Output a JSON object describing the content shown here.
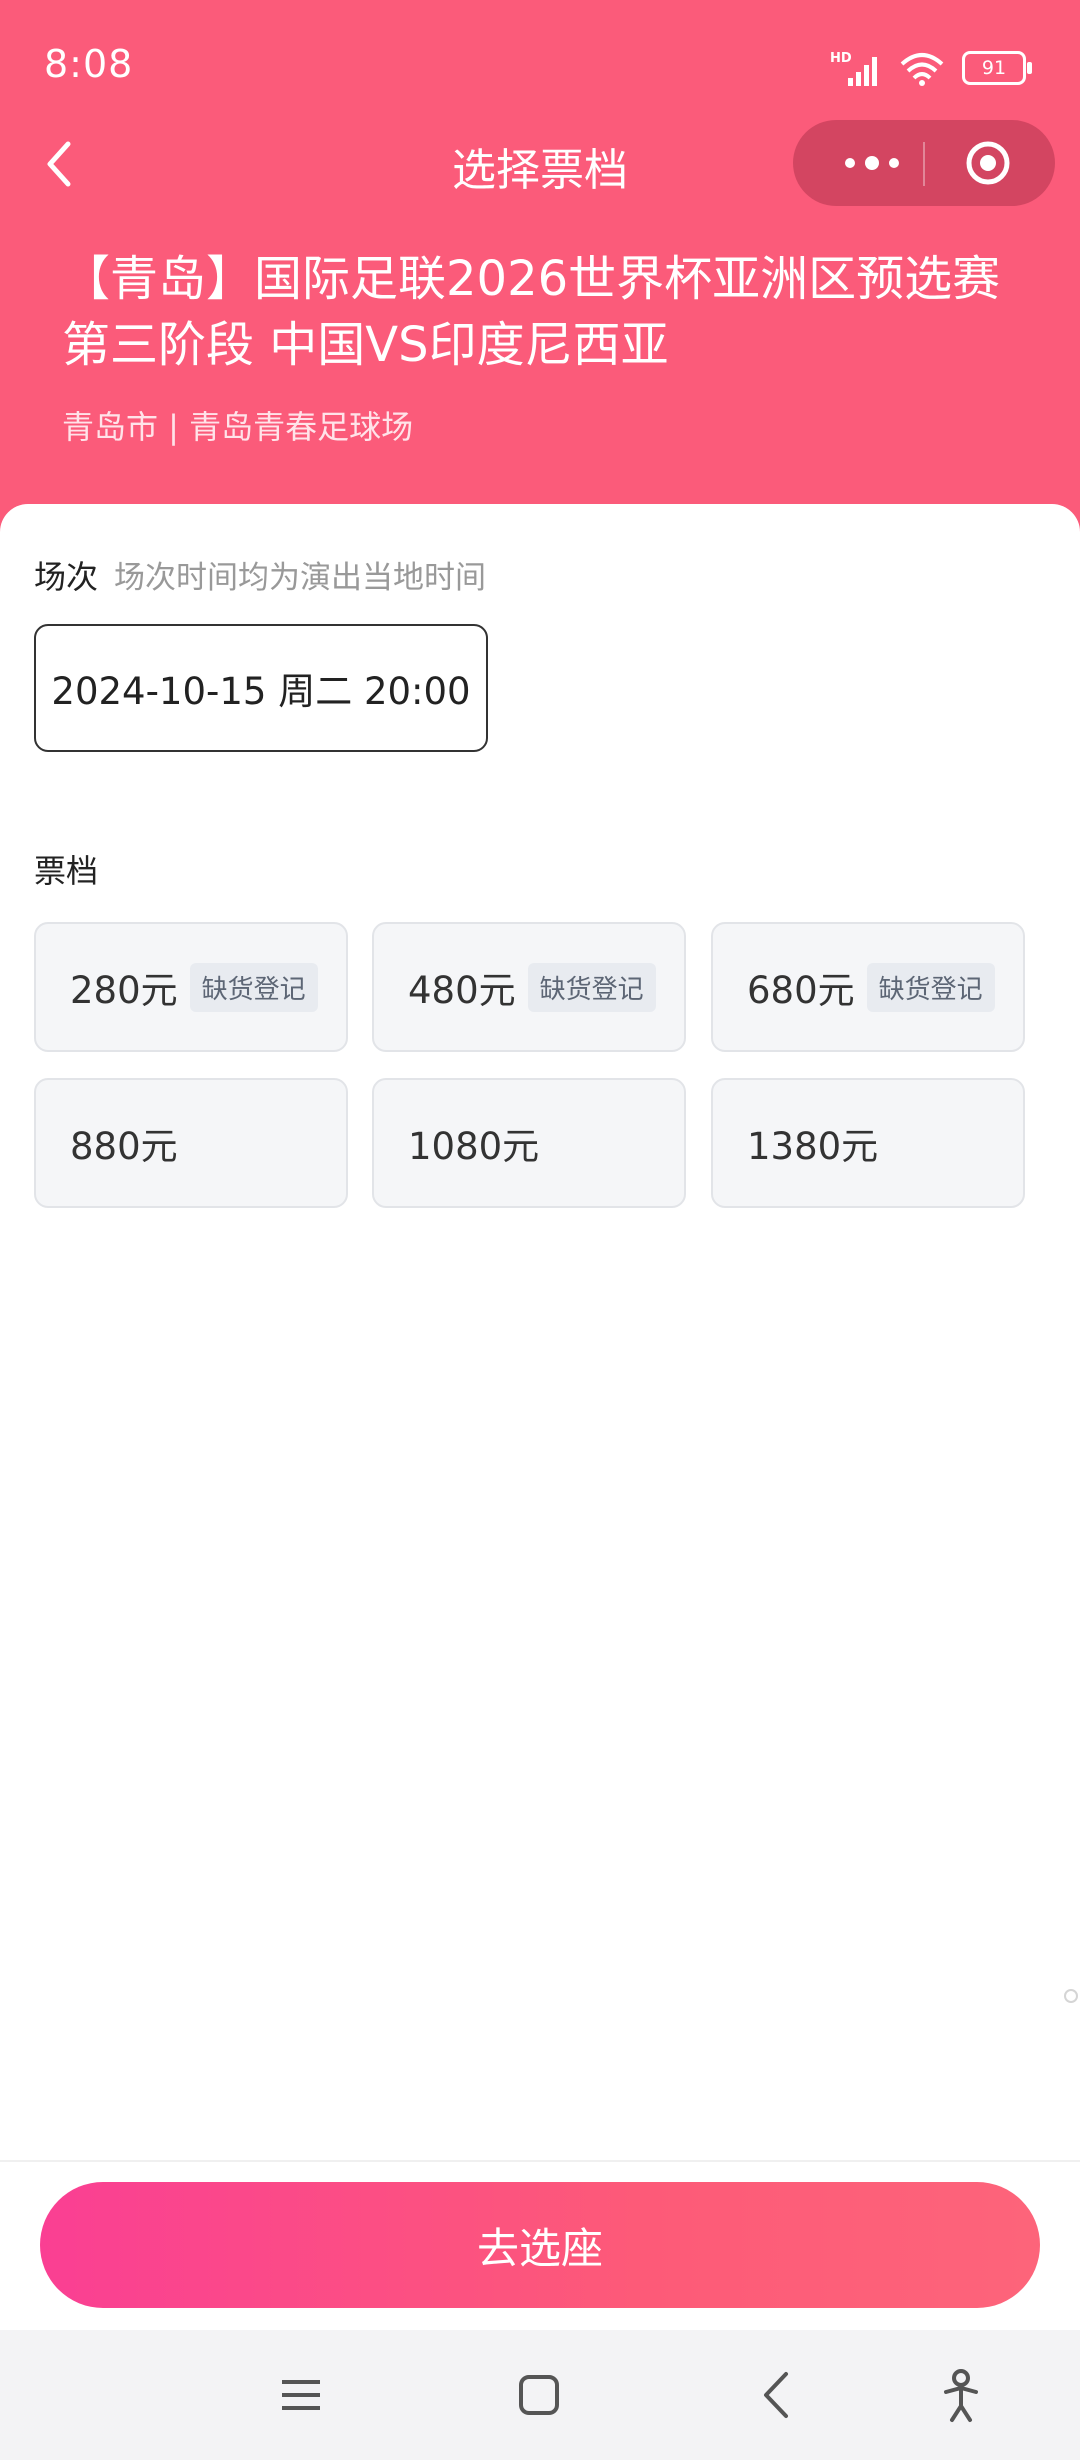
{
  "status": {
    "time": "8:08",
    "battery": "91",
    "network": "HD"
  },
  "nav": {
    "title": "选择票档"
  },
  "event": {
    "title": "【青岛】国际足联2026世界杯亚洲区预选赛第三阶段 中国VS印度尼西亚",
    "venue": "青岛市 | 青岛青春足球场"
  },
  "session": {
    "label": "场次",
    "hint": "场次时间均为演出当地时间",
    "selected": "2024-10-15 周二 20:00"
  },
  "tiers": {
    "label": "票档",
    "items": [
      {
        "price": "280元",
        "badge": "缺货登记"
      },
      {
        "price": "480元",
        "badge": "缺货登记"
      },
      {
        "price": "680元",
        "badge": "缺货登记"
      },
      {
        "price": "880元",
        "badge": ""
      },
      {
        "price": "1080元",
        "badge": ""
      },
      {
        "price": "1380元",
        "badge": ""
      }
    ]
  },
  "cta": {
    "label": "去选座"
  },
  "colors": {
    "header": "#fb5b7a",
    "cta_start": "#fa3f93",
    "cta_end": "#fd647a"
  }
}
